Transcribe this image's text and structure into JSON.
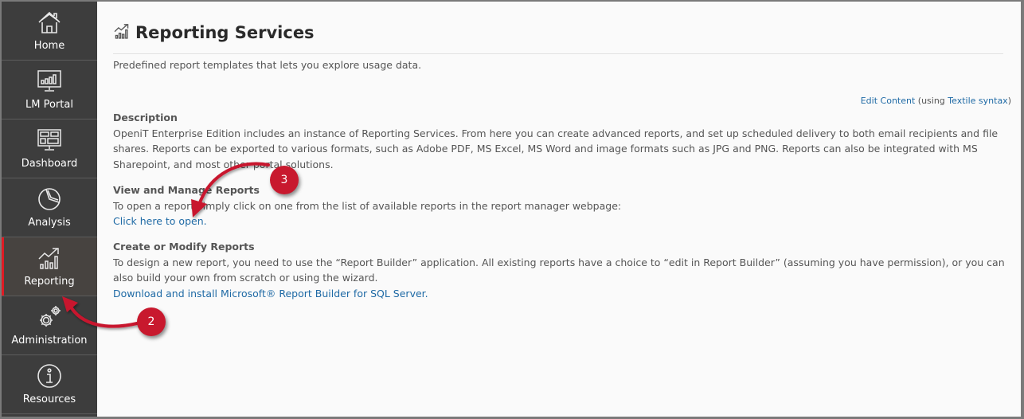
{
  "sidebar": {
    "items": [
      {
        "label": "Home",
        "icon": "home-icon"
      },
      {
        "label": "LM Portal",
        "icon": "monitor-chart-icon"
      },
      {
        "label": "Dashboard",
        "icon": "dashboard-icon"
      },
      {
        "label": "Analysis",
        "icon": "pie-chart-icon"
      },
      {
        "label": "Reporting",
        "icon": "reporting-chart-icon",
        "active": true
      },
      {
        "label": "Administration",
        "icon": "gears-icon"
      },
      {
        "label": "Resources",
        "icon": "info-icon"
      }
    ],
    "active_color": "#e01b24"
  },
  "page": {
    "title": "Reporting Services",
    "subtitle": "Predefined report templates that lets you explore usage data.",
    "edit_link": "Edit Content",
    "edit_prefix": "(using",
    "textile_link": "Textile syntax",
    "edit_suffix": ")"
  },
  "sections": {
    "description": {
      "heading": "Description",
      "body": "OpeniT Enterprise Edition includes an instance of Reporting Services. From here you can create advanced reports, and set up scheduled delivery to both email recipients and file shares. Reports can be exported to various formats, such as Adobe PDF, MS Excel, MS Word and image formats such as JPG and PNG. Reports can also be integrated with MS Sharepoint, and most other portal solutions."
    },
    "view": {
      "heading": "View and Manage Reports",
      "body": "To open a report simply click on one from the list of available reports in the report manager webpage:",
      "link": "Click here to open."
    },
    "create": {
      "heading": "Create or Modify Reports",
      "body": "To design a new report, you need to use the “Report Builder” application. All existing reports have a choice to “edit in Report Builder” (assuming you have permission), or you can also build your own from scratch or using the wizard.",
      "link": "Download and install Microsoft® Report Builder for SQL Server."
    }
  },
  "callouts": [
    {
      "number": "2",
      "color": "#c8192e"
    },
    {
      "number": "3",
      "color": "#c8192e"
    }
  ]
}
